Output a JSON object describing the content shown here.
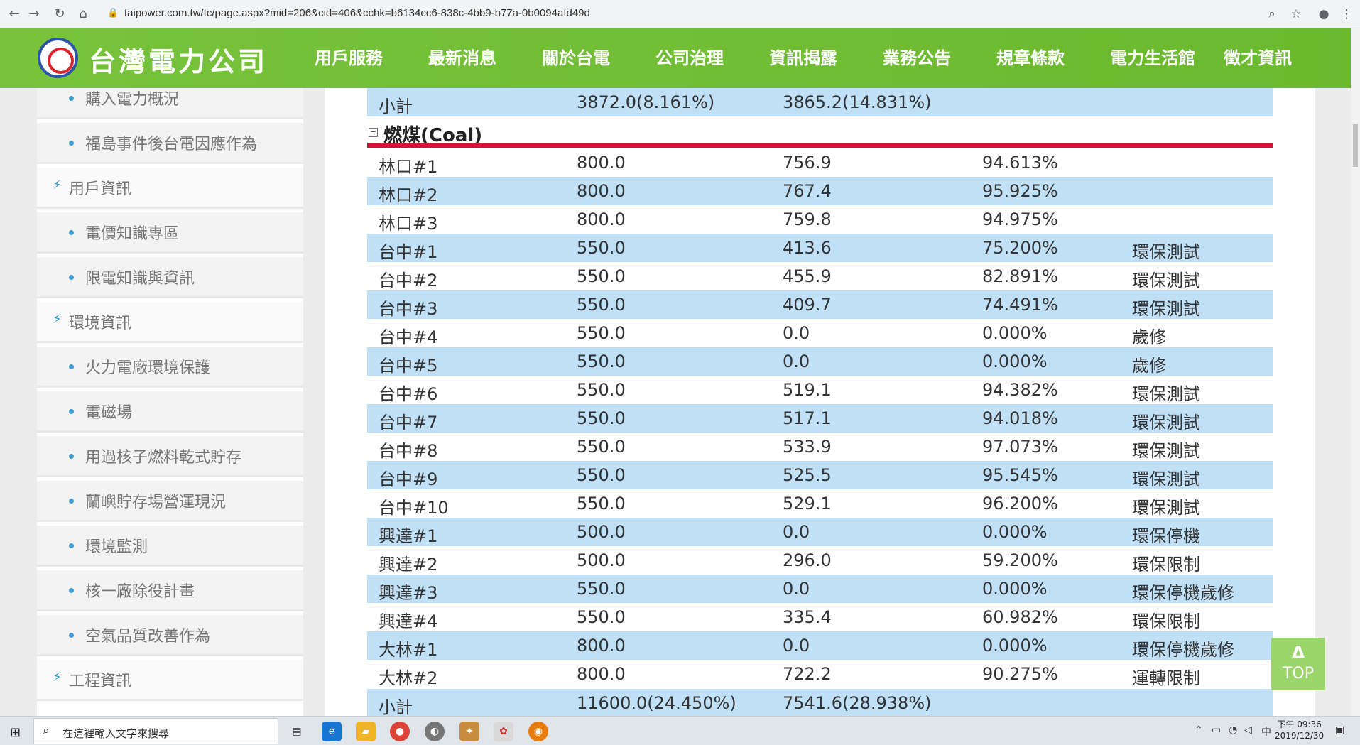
{
  "browser": {
    "url": "taipower.com.tw/tc/page.aspx?mid=206&cid=406&cchk=b6134cc6-838c-4bb9-b77a-0b0094afd49d"
  },
  "site": {
    "logo_text": "台灣電力公司",
    "menu": [
      "用戶服務",
      "最新消息",
      "關於台電",
      "公司治理",
      "資訊揭露",
      "業務公告",
      "規章條款",
      "電力生活館",
      "徵才資訊"
    ]
  },
  "sidebar": {
    "items": [
      {
        "label": "購入電力概況",
        "kind": "sub"
      },
      {
        "label": "福島事件後台電因應作為",
        "kind": "sub"
      },
      {
        "label": "用戶資訊",
        "kind": "cat"
      },
      {
        "label": "電價知識專區",
        "kind": "sub"
      },
      {
        "label": "限電知識與資訊",
        "kind": "sub"
      },
      {
        "label": "環境資訊",
        "kind": "cat"
      },
      {
        "label": "火力電廠環境保護",
        "kind": "sub"
      },
      {
        "label": "電磁場",
        "kind": "sub"
      },
      {
        "label": "用過核子燃料乾式貯存",
        "kind": "sub"
      },
      {
        "label": "蘭嶼貯存場營運現況",
        "kind": "sub"
      },
      {
        "label": "環境監測",
        "kind": "sub"
      },
      {
        "label": "核一廠除役計畫",
        "kind": "sub"
      },
      {
        "label": "空氣品質改善作為",
        "kind": "sub"
      },
      {
        "label": "工程資訊",
        "kind": "cat"
      }
    ]
  },
  "table": {
    "prev_subtotal": {
      "label": "小計",
      "capacity": "3872.0(8.161%)",
      "output": "3865.2(14.831%)"
    },
    "section_title": "燃煤(Coal)",
    "rows": [
      [
        "林口#1",
        "800.0",
        "756.9",
        "94.613%",
        ""
      ],
      [
        "林口#2",
        "800.0",
        "767.4",
        "95.925%",
        ""
      ],
      [
        "林口#3",
        "800.0",
        "759.8",
        "94.975%",
        ""
      ],
      [
        "台中#1",
        "550.0",
        "413.6",
        "75.200%",
        "環保測試"
      ],
      [
        "台中#2",
        "550.0",
        "455.9",
        "82.891%",
        "環保測試"
      ],
      [
        "台中#3",
        "550.0",
        "409.7",
        "74.491%",
        "環保測試"
      ],
      [
        "台中#4",
        "550.0",
        "0.0",
        "0.000%",
        "歲修"
      ],
      [
        "台中#5",
        "550.0",
        "0.0",
        "0.000%",
        "歲修"
      ],
      [
        "台中#6",
        "550.0",
        "519.1",
        "94.382%",
        "環保測試"
      ],
      [
        "台中#7",
        "550.0",
        "517.1",
        "94.018%",
        "環保測試"
      ],
      [
        "台中#8",
        "550.0",
        "533.9",
        "97.073%",
        "環保測試"
      ],
      [
        "台中#9",
        "550.0",
        "525.5",
        "95.545%",
        "環保測試"
      ],
      [
        "台中#10",
        "550.0",
        "529.1",
        "96.200%",
        "環保測試"
      ],
      [
        "興達#1",
        "500.0",
        "0.0",
        "0.000%",
        "環保停機"
      ],
      [
        "興達#2",
        "500.0",
        "296.0",
        "59.200%",
        "環保限制"
      ],
      [
        "興達#3",
        "550.0",
        "0.0",
        "0.000%",
        "環保停機歲修"
      ],
      [
        "興達#4",
        "550.0",
        "335.4",
        "60.982%",
        "環保限制"
      ],
      [
        "大林#1",
        "800.0",
        "0.0",
        "0.000%",
        "環保停機歲修"
      ],
      [
        "大林#2",
        "800.0",
        "722.2",
        "90.275%",
        "運轉限制"
      ]
    ],
    "subtotal": {
      "label": "小計",
      "capacity": "11600.0(24.450%)",
      "output": "7541.6(28.938%)"
    }
  },
  "top_button": {
    "arrow": "Δ",
    "label": "TOP"
  },
  "taskbar": {
    "search_placeholder": "在這裡輸入文字來搜尋",
    "ime": "中",
    "time": "下午 09:36",
    "date": "2019/12/30"
  },
  "colors": {
    "header_green": "#6bb92e",
    "row_blue": "#bfe0f7",
    "section_red": "#d2143a",
    "top_button": "#9bd66a"
  }
}
